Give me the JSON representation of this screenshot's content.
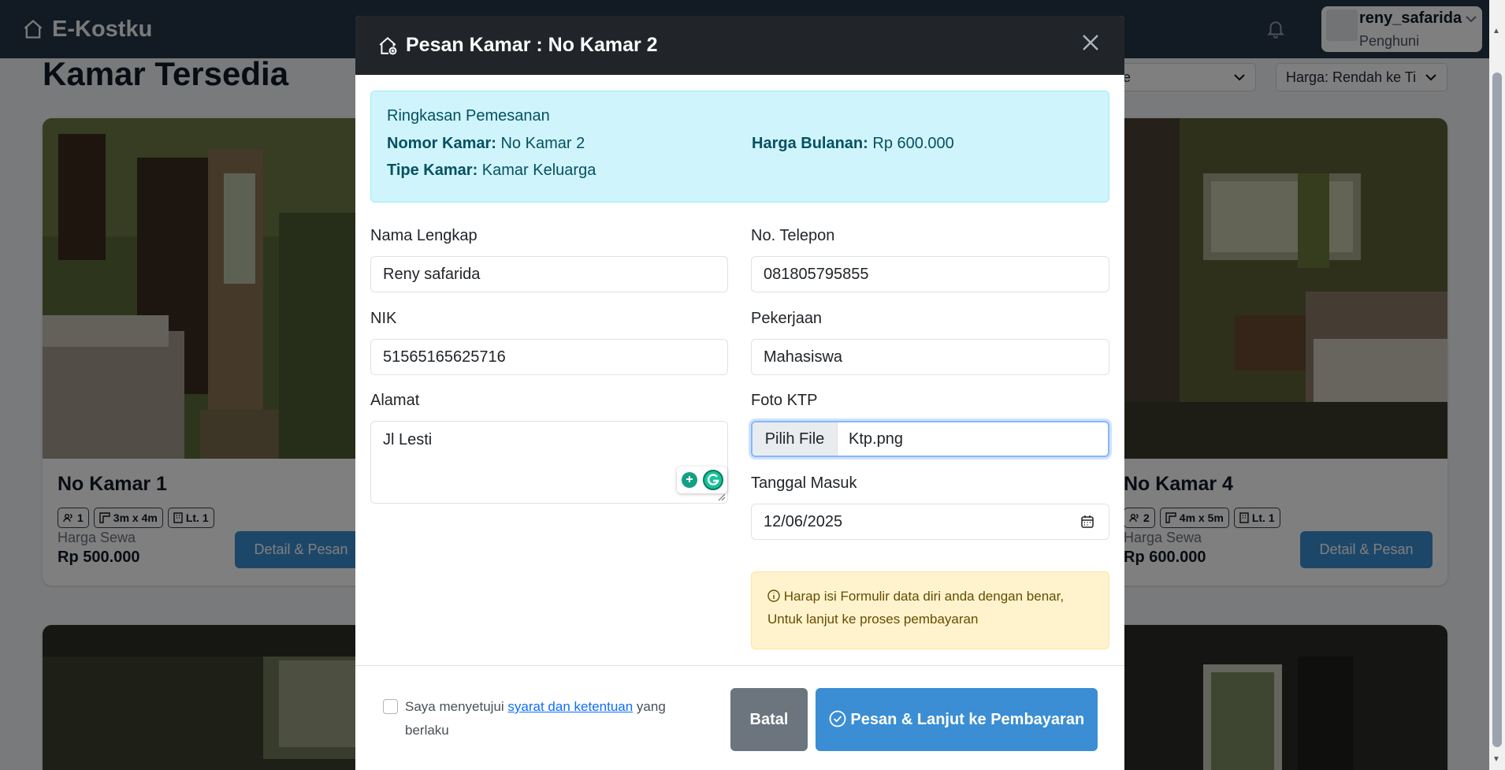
{
  "navbar": {
    "brand": "E-Kostku",
    "user_name": "reny_safarida",
    "user_role": "Penghuni"
  },
  "page": {
    "title": "Kamar Tersedia"
  },
  "filters": {
    "type": "Semua Tipe",
    "sort": "Harga: Rendah ke Ti"
  },
  "cards": [
    {
      "name": "No Kamar 1",
      "capacity": "1",
      "size": "3m x 4m",
      "floor": "Lt. 1",
      "price_label": "Harga Sewa",
      "price": "Rp 500.000",
      "button": "Detail & Pesan"
    },
    {
      "name": "No Kamar 4",
      "capacity": "2",
      "size": "4m x 5m",
      "floor": "Lt. 1",
      "price_label": "Harga Sewa",
      "price": "Rp 600.000",
      "button": "Detail & Pesan"
    }
  ],
  "modal": {
    "title": "Pesan Kamar : No Kamar 2",
    "summary": {
      "title": "Ringkasan Pemesanan",
      "room_label": "Nomor Kamar:",
      "room_value": "No Kamar 2",
      "price_label": "Harga Bulanan:",
      "price_value": "Rp 600.000",
      "type_label": "Tipe Kamar:",
      "type_value": "Kamar Keluarga"
    },
    "fields": {
      "name_label": "Nama Lengkap",
      "name_value": "Reny safarida",
      "phone_label": "No. Telepon",
      "phone_value": "081805795855",
      "nik_label": "NIK",
      "nik_value": "51565165625716",
      "job_label": "Pekerjaan",
      "job_value": "Mahasiswa",
      "address_label": "Alamat",
      "address_value": "Jl Lesti",
      "ktp_label": "Foto KTP",
      "ktp_button": "Pilih File",
      "ktp_file": "Ktp.png",
      "date_label": "Tanggal Masuk",
      "date_value": "12/06/2025"
    },
    "warning": "Harap isi Formulir data diri anda dengan benar, Untuk lanjut ke proses pembayaran",
    "agree": {
      "prefix": "Saya menyetujui ",
      "link": "syarat dan ketentuan",
      "suffix": " yang berlaku"
    },
    "buttons": {
      "cancel": "Batal",
      "submit": "Pesan & Lanjut ke Pembayaran"
    }
  },
  "icons": [
    "home-icon",
    "bell-icon",
    "chevron-down-icon",
    "house-plus-icon",
    "close-icon",
    "users-icon",
    "ruler-icon",
    "building-icon",
    "info-icon",
    "calendar-icon",
    "check-circle-icon",
    "grammarly-icon"
  ],
  "colors": {
    "navbar": "#243447",
    "accent": "#3b8ed3",
    "summary_bg": "#cff4fc",
    "warning_bg": "#fff3cd",
    "modal_header": "#212529"
  }
}
